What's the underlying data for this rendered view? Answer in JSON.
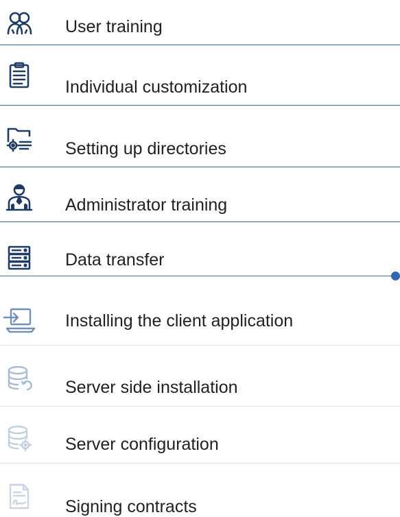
{
  "colors": {
    "icon_dark": "#1f3b63",
    "icon_light": "#8ea6c2",
    "icon_faint": "#b8c8da",
    "divider": "#3e6a9c",
    "divider_light": "#d7dde4",
    "accent": "#2f66b3"
  },
  "items": [
    {
      "label": "User training",
      "icon": "users-icon"
    },
    {
      "label": "Individual customization",
      "icon": "clipboard-icon"
    },
    {
      "label": "Setting up directories",
      "icon": "folder-gear-icon"
    },
    {
      "label": "Administrator training",
      "icon": "admin-icon"
    },
    {
      "label": "Data transfer",
      "icon": "server-transfer-icon"
    },
    {
      "label": "Installing the client application",
      "icon": "laptop-install-icon"
    },
    {
      "label": "Server side installation",
      "icon": "database-refresh-icon"
    },
    {
      "label": "Server configuration",
      "icon": "database-gear-icon"
    },
    {
      "label": "Signing contracts",
      "icon": "contract-signature-icon"
    }
  ]
}
